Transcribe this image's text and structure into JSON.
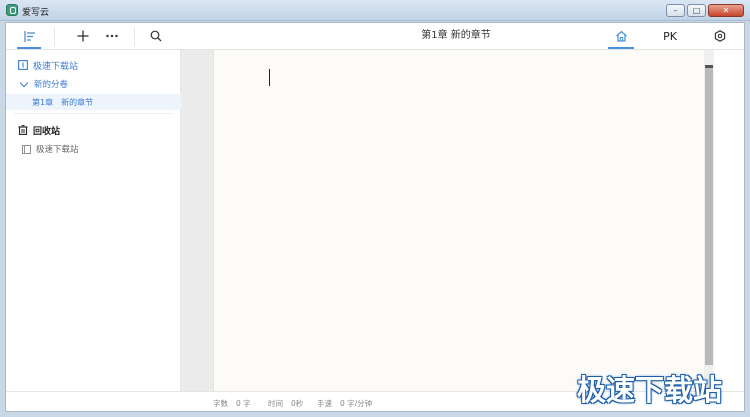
{
  "window": {
    "title": "爱写云"
  },
  "toolbar": {
    "chapter_title": "第1章  新的章节",
    "pk_label": "PK"
  },
  "sidebar": {
    "book_title": "极速下载站",
    "volume_title": "新的分卷",
    "chapter_number": "第1章",
    "chapter_name": "新的章节",
    "trash_label": "回收站",
    "trash_item": "极速下载站"
  },
  "status": {
    "word_count_label": "字数",
    "word_count_value": "0 字",
    "time_label": "时间",
    "time_value": "0秒",
    "speed_label": "手速",
    "speed_value": "0 字/分钟"
  },
  "watermark": {
    "text": "极速下载站"
  },
  "colors": {
    "accent": "#3a7bd5",
    "editor_paper": "#fcfbf8",
    "watermark_outline": "#1e5fa8"
  },
  "icons": [
    "outline-icon",
    "plus-icon",
    "more-icon",
    "search-icon",
    "home-icon",
    "settings-icon",
    "book-icon",
    "chevron-down-icon",
    "trash-icon",
    "document-icon"
  ]
}
